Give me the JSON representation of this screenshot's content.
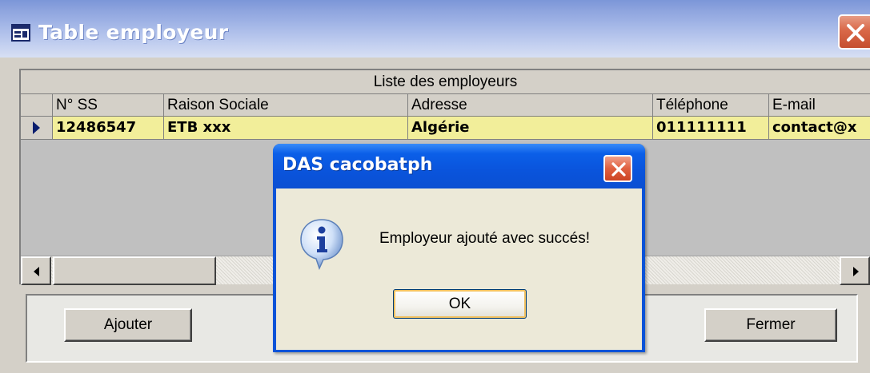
{
  "window": {
    "title": "Table employeur",
    "close_label": "X"
  },
  "grid": {
    "caption": "Liste des employeurs",
    "columns": [
      "N° SS",
      "Raison Sociale",
      "Adresse",
      "Téléphone",
      "E-mail"
    ],
    "rows": [
      {
        "n_ss": "12486547",
        "raison_sociale": "ETB xxx",
        "adresse": "Algérie",
        "telephone": "011111111",
        "email": "contact@x"
      }
    ],
    "selected_row_color": "#f2ee9a"
  },
  "buttons": {
    "ajouter": "Ajouter",
    "fermer": "Fermer"
  },
  "message_box": {
    "title": "DAS cacobatph",
    "icon": "info-icon",
    "text": "Employeur ajouté avec succés!",
    "ok_label": "OK"
  },
  "colors": {
    "window_title_gradient_top": "#7b96d8",
    "dialog_title_blue": "#0a54dc",
    "close_red": "#d96848",
    "dialog_body": "#ece9d8",
    "form_gray": "#d4d0c8"
  }
}
